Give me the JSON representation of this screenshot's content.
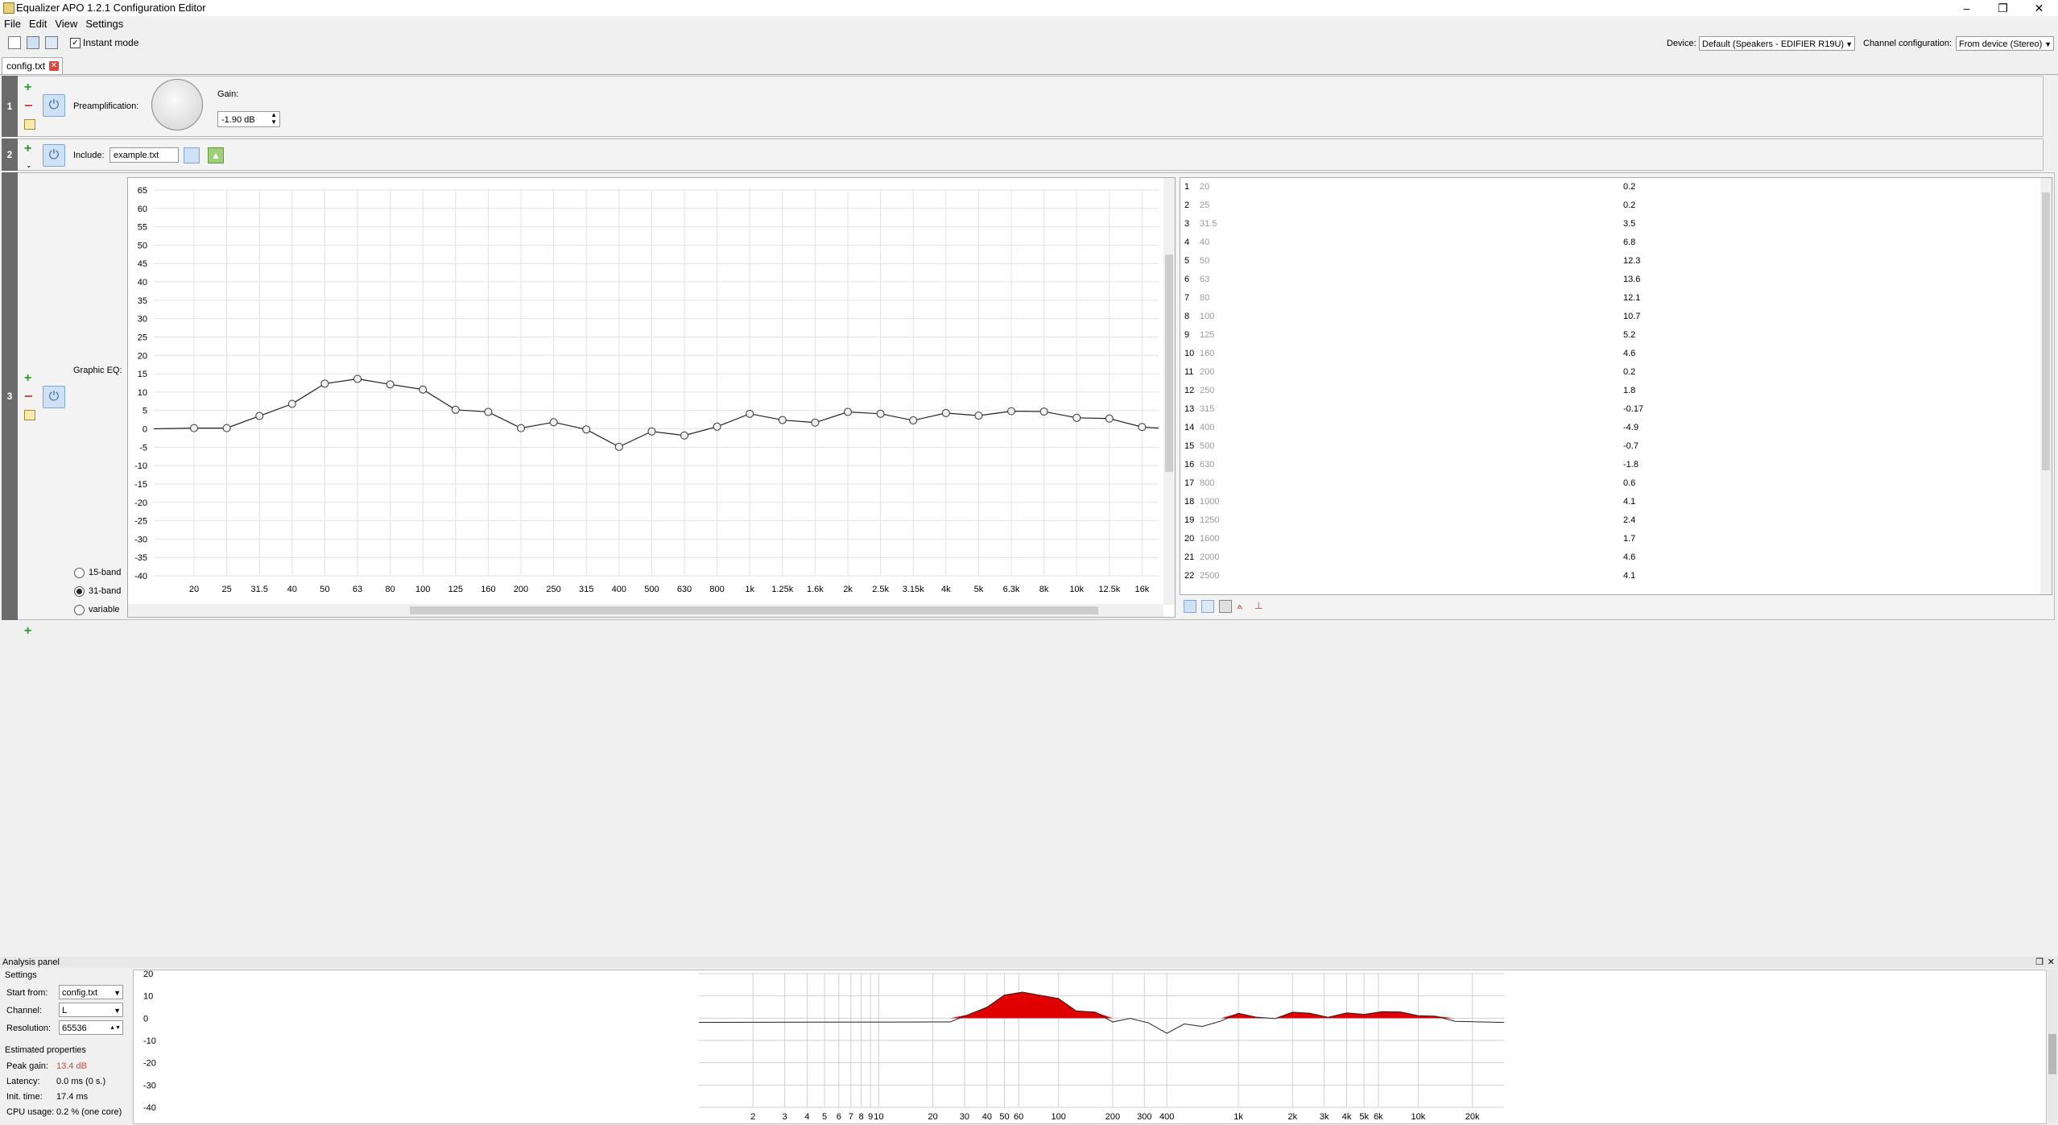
{
  "window": {
    "title": "Equalizer APO 1.2.1 Configuration Editor"
  },
  "menu": [
    "File",
    "Edit",
    "View",
    "Settings"
  ],
  "toolbar": {
    "instant_mode_label": "Instant mode",
    "instant_mode_checked": true,
    "device_label": "Device:",
    "device_value": "Default (Speakers - EDIFIER R19U)",
    "channel_config_label": "Channel configuration:",
    "channel_config_value": "From device (Stereo)"
  },
  "tabs": [
    {
      "label": "config.txt"
    }
  ],
  "filters": [
    {
      "number": "1",
      "name": "Preamplification:",
      "gain_label": "Gain:",
      "gain_value": "-1.90 dB"
    },
    {
      "number": "2",
      "name": "Include:",
      "file_value": "example.txt"
    },
    {
      "number": "3",
      "name": "Graphic EQ:",
      "band_options": [
        "15-band",
        "31-band",
        "variable"
      ],
      "selected_band": "31-band"
    }
  ],
  "graphic_eq": {
    "y_ticks": [
      "65",
      "60",
      "55",
      "50",
      "45",
      "40",
      "35",
      "30",
      "25",
      "20",
      "15",
      "10",
      "5",
      "0",
      "-5",
      "-10",
      "-15",
      "-20",
      "-25",
      "-30",
      "-35",
      "-40"
    ],
    "x_labels": [
      "20",
      "25",
      "31.5",
      "40",
      "50",
      "63",
      "80",
      "100",
      "125",
      "160",
      "200",
      "250",
      "315",
      "400",
      "500",
      "630",
      "800",
      "1k",
      "1.25k",
      "1.6k",
      "2k",
      "2.5k",
      "3.15k",
      "4k",
      "5k",
      "6.3k",
      "8k",
      "10k",
      "12.5k",
      "16k"
    ],
    "gains": [
      0.2,
      0.2,
      3.5,
      6.8,
      12.3,
      13.6,
      12.1,
      10.7,
      5.2,
      4.6,
      0.2,
      1.8,
      -0.17,
      -4.9,
      -0.7,
      -1.8,
      0.6,
      4.1,
      2.4,
      1.7,
      4.6,
      4.1,
      2.3,
      4.3,
      3.6,
      4.8,
      4.7,
      3,
      2.8,
      0.5
    ]
  },
  "band_table": {
    "rows": [
      {
        "n": "1",
        "freq": "20",
        "gain": "0.2"
      },
      {
        "n": "2",
        "freq": "25",
        "gain": "0.2"
      },
      {
        "n": "3",
        "freq": "31.5",
        "gain": "3.5"
      },
      {
        "n": "4",
        "freq": "40",
        "gain": "6.8"
      },
      {
        "n": "5",
        "freq": "50",
        "gain": "12.3"
      },
      {
        "n": "6",
        "freq": "63",
        "gain": "13.6"
      },
      {
        "n": "7",
        "freq": "80",
        "gain": "12.1"
      },
      {
        "n": "8",
        "freq": "100",
        "gain": "10.7"
      },
      {
        "n": "9",
        "freq": "125",
        "gain": "5.2"
      },
      {
        "n": "10",
        "freq": "160",
        "gain": "4.6"
      },
      {
        "n": "11",
        "freq": "200",
        "gain": "0.2"
      },
      {
        "n": "12",
        "freq": "250",
        "gain": "1.8"
      },
      {
        "n": "13",
        "freq": "315",
        "gain": "-0.17"
      },
      {
        "n": "14",
        "freq": "400",
        "gain": "-4.9"
      },
      {
        "n": "15",
        "freq": "500",
        "gain": "-0.7"
      },
      {
        "n": "16",
        "freq": "630",
        "gain": "-1.8"
      },
      {
        "n": "17",
        "freq": "800",
        "gain": "0.6"
      },
      {
        "n": "18",
        "freq": "1000",
        "gain": "4.1"
      },
      {
        "n": "19",
        "freq": "1250",
        "gain": "2.4"
      },
      {
        "n": "20",
        "freq": "1600",
        "gain": "1.7"
      },
      {
        "n": "21",
        "freq": "2000",
        "gain": "4.6"
      },
      {
        "n": "22",
        "freq": "2500",
        "gain": "4.1"
      }
    ]
  },
  "analysis": {
    "title": "Analysis panel",
    "settings_label": "Settings",
    "start_from_label": "Start from:",
    "start_from_value": "config.txt",
    "channel_label": "Channel:",
    "channel_value": "L",
    "resolution_label": "Resolution:",
    "resolution_value": "65536",
    "estimated_label": "Estimated properties",
    "peak_gain_label": "Peak gain:",
    "peak_gain_value": "13.4 dB",
    "latency_label": "Latency:",
    "latency_value": "0.0 ms (0 s.)",
    "init_time_label": "Init. time:",
    "init_time_value": "17.4 ms",
    "cpu_label": "CPU usage:",
    "cpu_value": "0.2 % (one core)",
    "y_ticks": [
      "20",
      "10",
      "0",
      "-10",
      "-20",
      "-30",
      "-40"
    ],
    "x_labels": [
      "2",
      "3",
      "4",
      "5",
      "6",
      "7",
      "8",
      "9",
      "10",
      "20",
      "30",
      "40",
      "50",
      "60",
      "100",
      "200",
      "300",
      "400",
      "1k",
      "2k",
      "3k",
      "4k",
      "5k",
      "6k",
      "10k",
      "20k"
    ]
  },
  "colors": {
    "accent": "#3d6fa8",
    "response_fill": "#e00000",
    "peak_gain": "#d9443b"
  }
}
